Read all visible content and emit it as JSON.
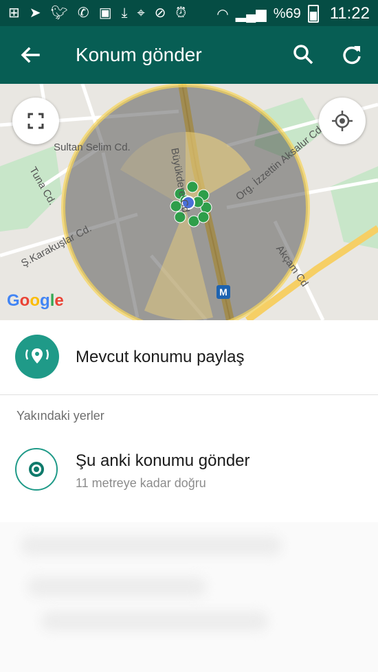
{
  "status_bar": {
    "icons": [
      "plus-square-icon",
      "navigation-icon",
      "twitter-icon",
      "whatsapp-icon",
      "image-icon",
      "download-icon",
      "location-pin-icon",
      "mute-icon",
      "alarm-icon",
      "wifi-icon",
      "signal-icon",
      "battery-icon"
    ],
    "battery": "%69",
    "time": "11:22"
  },
  "header": {
    "title": "Konum gönder",
    "back_icon": "arrow-back-icon",
    "search_icon": "search-icon",
    "refresh_icon": "refresh-icon"
  },
  "map": {
    "expand_icon": "fullscreen-icon",
    "locate_icon": "my-location-icon",
    "street_labels": [
      "Sultan Selim Cd.",
      "Büyükdere Cd.",
      "Org. İzzettin Aksalur Cd.",
      "Tuna Cd.",
      "Ş.Karakuşlar Cd.",
      "Akçam Cd"
    ],
    "attribution": "Google",
    "metro_label": "M",
    "colors": {
      "background": "#e9e7e2",
      "park": "#c8e6c9",
      "highway": "#f6cf65",
      "marker": "#2e9e4a"
    }
  },
  "share_current": {
    "icon": "live-location-icon",
    "label": "Mevcut konumu paylaş"
  },
  "nearby": {
    "heading": "Yakındaki yerler",
    "items": [
      {
        "icon": "radio-selected-icon",
        "title": "Şu anki konumu gönder",
        "subtitle": "11 metreye kadar doğru"
      }
    ]
  },
  "colors": {
    "status_bar": "#054d44",
    "app_bar": "#075e54",
    "accent": "#1f9a88"
  }
}
